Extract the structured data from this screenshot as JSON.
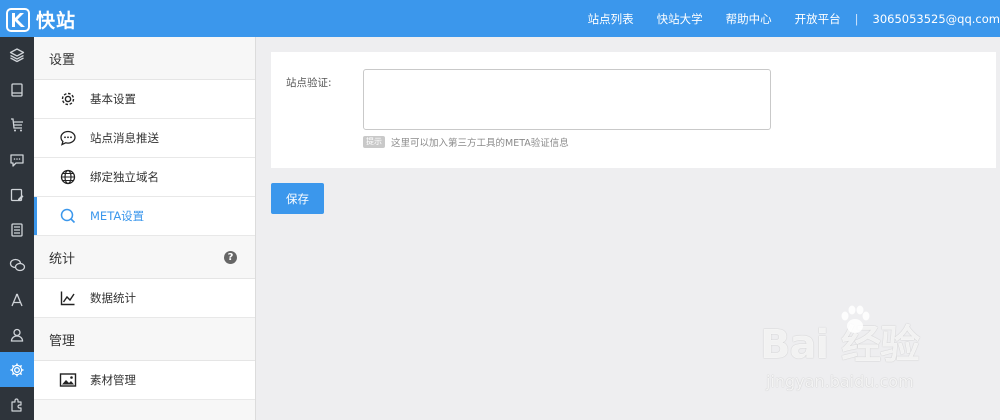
{
  "brand": {
    "name": "快站"
  },
  "top_nav": {
    "links": [
      "站点列表",
      "快站大学",
      "帮助中心",
      "开放平台"
    ],
    "separator": "|",
    "user_email": "3065053525@qq.com"
  },
  "rail": {
    "icons": [
      "layers-icon",
      "tablet-icon",
      "cart-icon",
      "chat-icon",
      "edit-icon",
      "list-icon",
      "wechat-icon",
      "compass-icon",
      "user-icon",
      "settings-icon",
      "plugin-icon"
    ],
    "active_index": 9
  },
  "sidebar": {
    "sections": [
      {
        "title": "设置",
        "items": [
          {
            "label": "基本设置",
            "icon": "gear-icon"
          },
          {
            "label": "站点消息推送",
            "icon": "message-icon"
          },
          {
            "label": "绑定独立域名",
            "icon": "globe-icon"
          },
          {
            "label": "META设置",
            "icon": "search-icon",
            "active": true
          }
        ]
      },
      {
        "title": "统计",
        "help": "?",
        "items": [
          {
            "label": "数据统计",
            "icon": "chart-icon"
          }
        ]
      },
      {
        "title": "管理",
        "items": [
          {
            "label": "素材管理",
            "icon": "image-icon"
          }
        ]
      }
    ]
  },
  "form": {
    "verify_label": "站点验证:",
    "verify_value": "",
    "hint_badge": "提示",
    "hint_text": "这里可以加入第三方工具的META验证信息",
    "save_label": "保存"
  },
  "watermark": {
    "logo": "Bai 经验",
    "sub": "jingyan.baidu.com"
  },
  "colors": {
    "accent": "#3b97ec",
    "rail_bg": "#2e343b",
    "page_bg": "#eeeef0"
  }
}
